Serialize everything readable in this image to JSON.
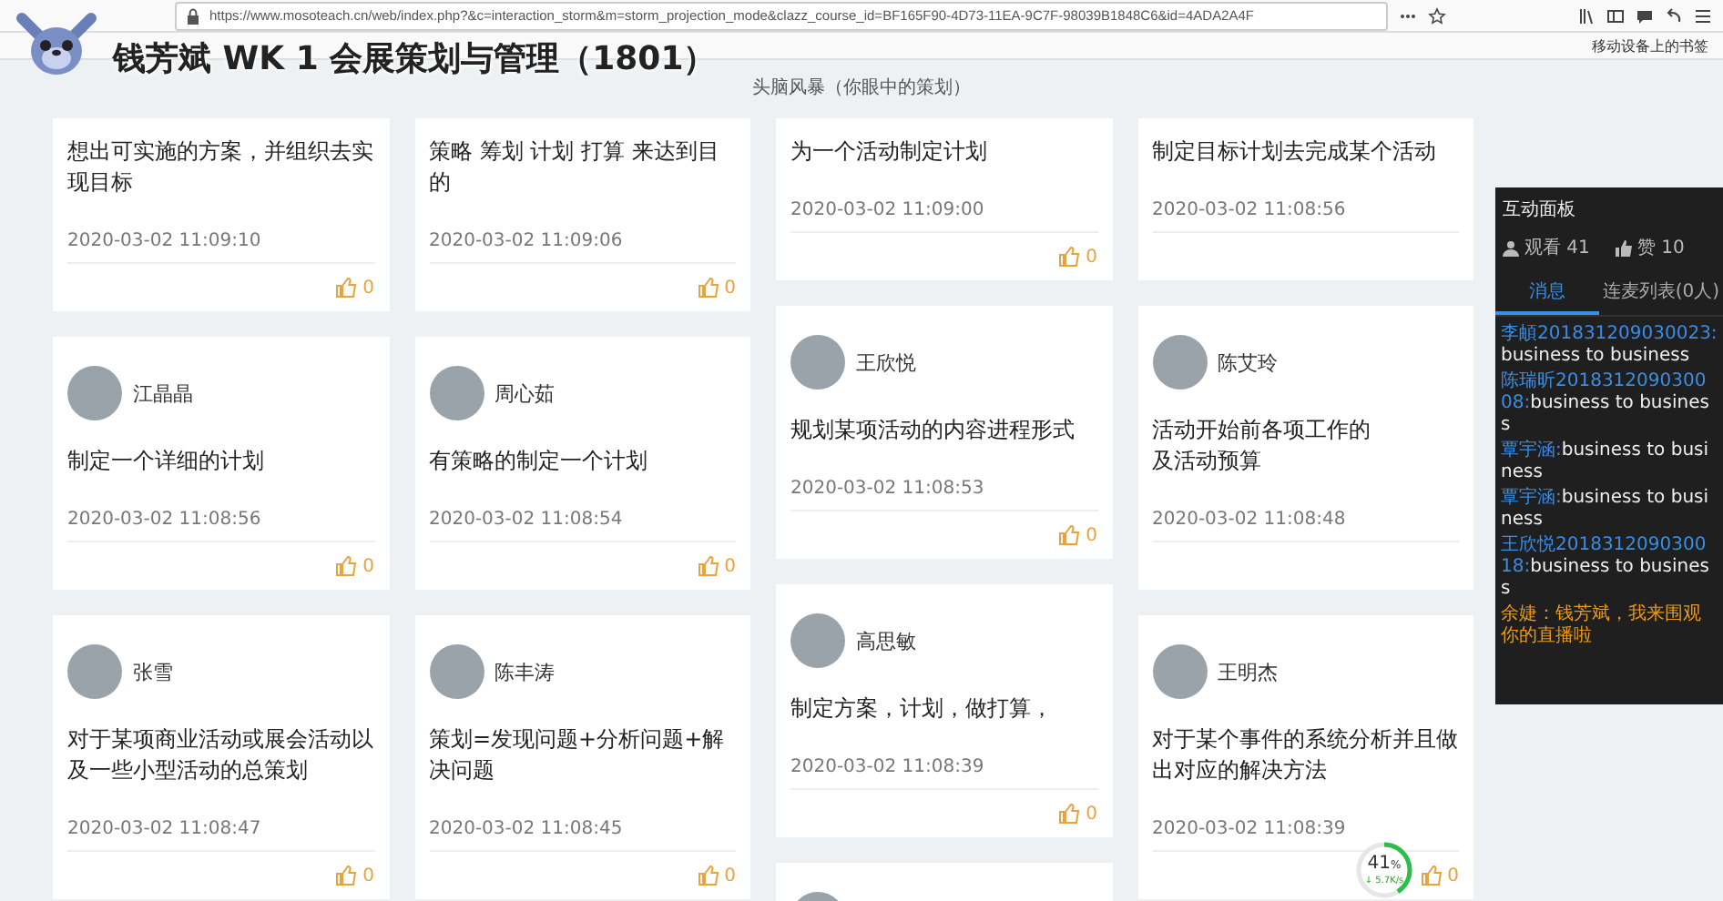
{
  "browser": {
    "url": "https://www.mosoteach.cn/web/index.php?&c=interaction_storm&m=storm_projection_mode&clazz_course_id=BF165F90-4D73-11EA-9C7F-98039B1848C6&id=4ADA2A4F",
    "bookmark": "移动设备上的书签"
  },
  "stream_title": "钱芳斌 WK 1 会展策划与管理（1801）",
  "page_title": "头脑风暴（你眼中的策划）",
  "columns": [
    {
      "cards": [
        {
          "text": "想出可实施的方案，并组织去实现目标",
          "time": "2020-03-02 11:09:10",
          "likes": "0"
        },
        {
          "author": "江晶晶",
          "text": "制定一个详细的计划",
          "time": "2020-03-02 11:08:56",
          "likes": "0"
        },
        {
          "author": "张雪",
          "text": "对于某项商业活动或展会活动以及一些小型活动的总策划",
          "time": "2020-03-02 11:08:47",
          "likes": "0"
        }
      ]
    },
    {
      "cards": [
        {
          "text": "策略 筹划 计划 打算 来达到目的",
          "time": "2020-03-02 11:09:06",
          "likes": "0"
        },
        {
          "author": "周心茹",
          "text": "有策略的制定一个计划",
          "time": "2020-03-02 11:08:54",
          "likes": "0"
        },
        {
          "author": "陈丰涛",
          "text": "策划=发现问题+分析问题+解决问题",
          "time": "2020-03-02 11:08:45",
          "likes": "0"
        }
      ]
    },
    {
      "cards": [
        {
          "text": "为一个活动制定计划",
          "time": "2020-03-02 11:09:00",
          "likes": "0"
        },
        {
          "author": "王欣悦",
          "text": "规划某项活动的内容进程形式",
          "time": "2020-03-02 11:08:53",
          "likes": "0"
        },
        {
          "author": "高思敏",
          "text": "制定方案，计划，做打算，",
          "time": "2020-03-02 11:08:39",
          "likes": "0"
        },
        {
          "avatar_only": true
        }
      ]
    },
    {
      "cards": [
        {
          "text": "制定目标计划去完成某个活动",
          "time": "2020-03-02 11:08:56"
        },
        {
          "author": "陈艾玲",
          "text": "活动开始前各项工作的",
          "text_2": "及活动预算",
          "time": "2020-03-02 11:08:48"
        },
        {
          "author": "王明杰",
          "text": "对于某个事件的系统分析并且做出对应的解决方法",
          "time": "2020-03-02 11:08:39",
          "likes": "0"
        }
      ]
    }
  ],
  "panel": {
    "title": "互动面板",
    "viewers": "观看 41",
    "likes": "赞 10",
    "tabs": [
      {
        "label": "消息",
        "selected": true
      },
      {
        "label": "连麦列表(0人)",
        "selected": false
      }
    ],
    "messages": [
      {
        "kind": "chat",
        "name": "李頔201831209030023:",
        "text": "business to business"
      },
      {
        "kind": "chat",
        "name": "陈瑞昕201831209030008:",
        "text": "business to business"
      },
      {
        "kind": "chat",
        "name": "覃宇涵:",
        "text": "business to business"
      },
      {
        "kind": "chat",
        "name": "覃宇涵:",
        "text": "business to business"
      },
      {
        "kind": "chat",
        "name": "王欣悦201831209030018:",
        "text": "business to business"
      },
      {
        "kind": "system",
        "name": "余婕：",
        "text": "钱芳斌，我来围观你的直播啦"
      }
    ]
  },
  "speed_widget": {
    "percent": "41",
    "unit": "%",
    "speed": "↓ 5.7K/s",
    "level": 0.41
  }
}
